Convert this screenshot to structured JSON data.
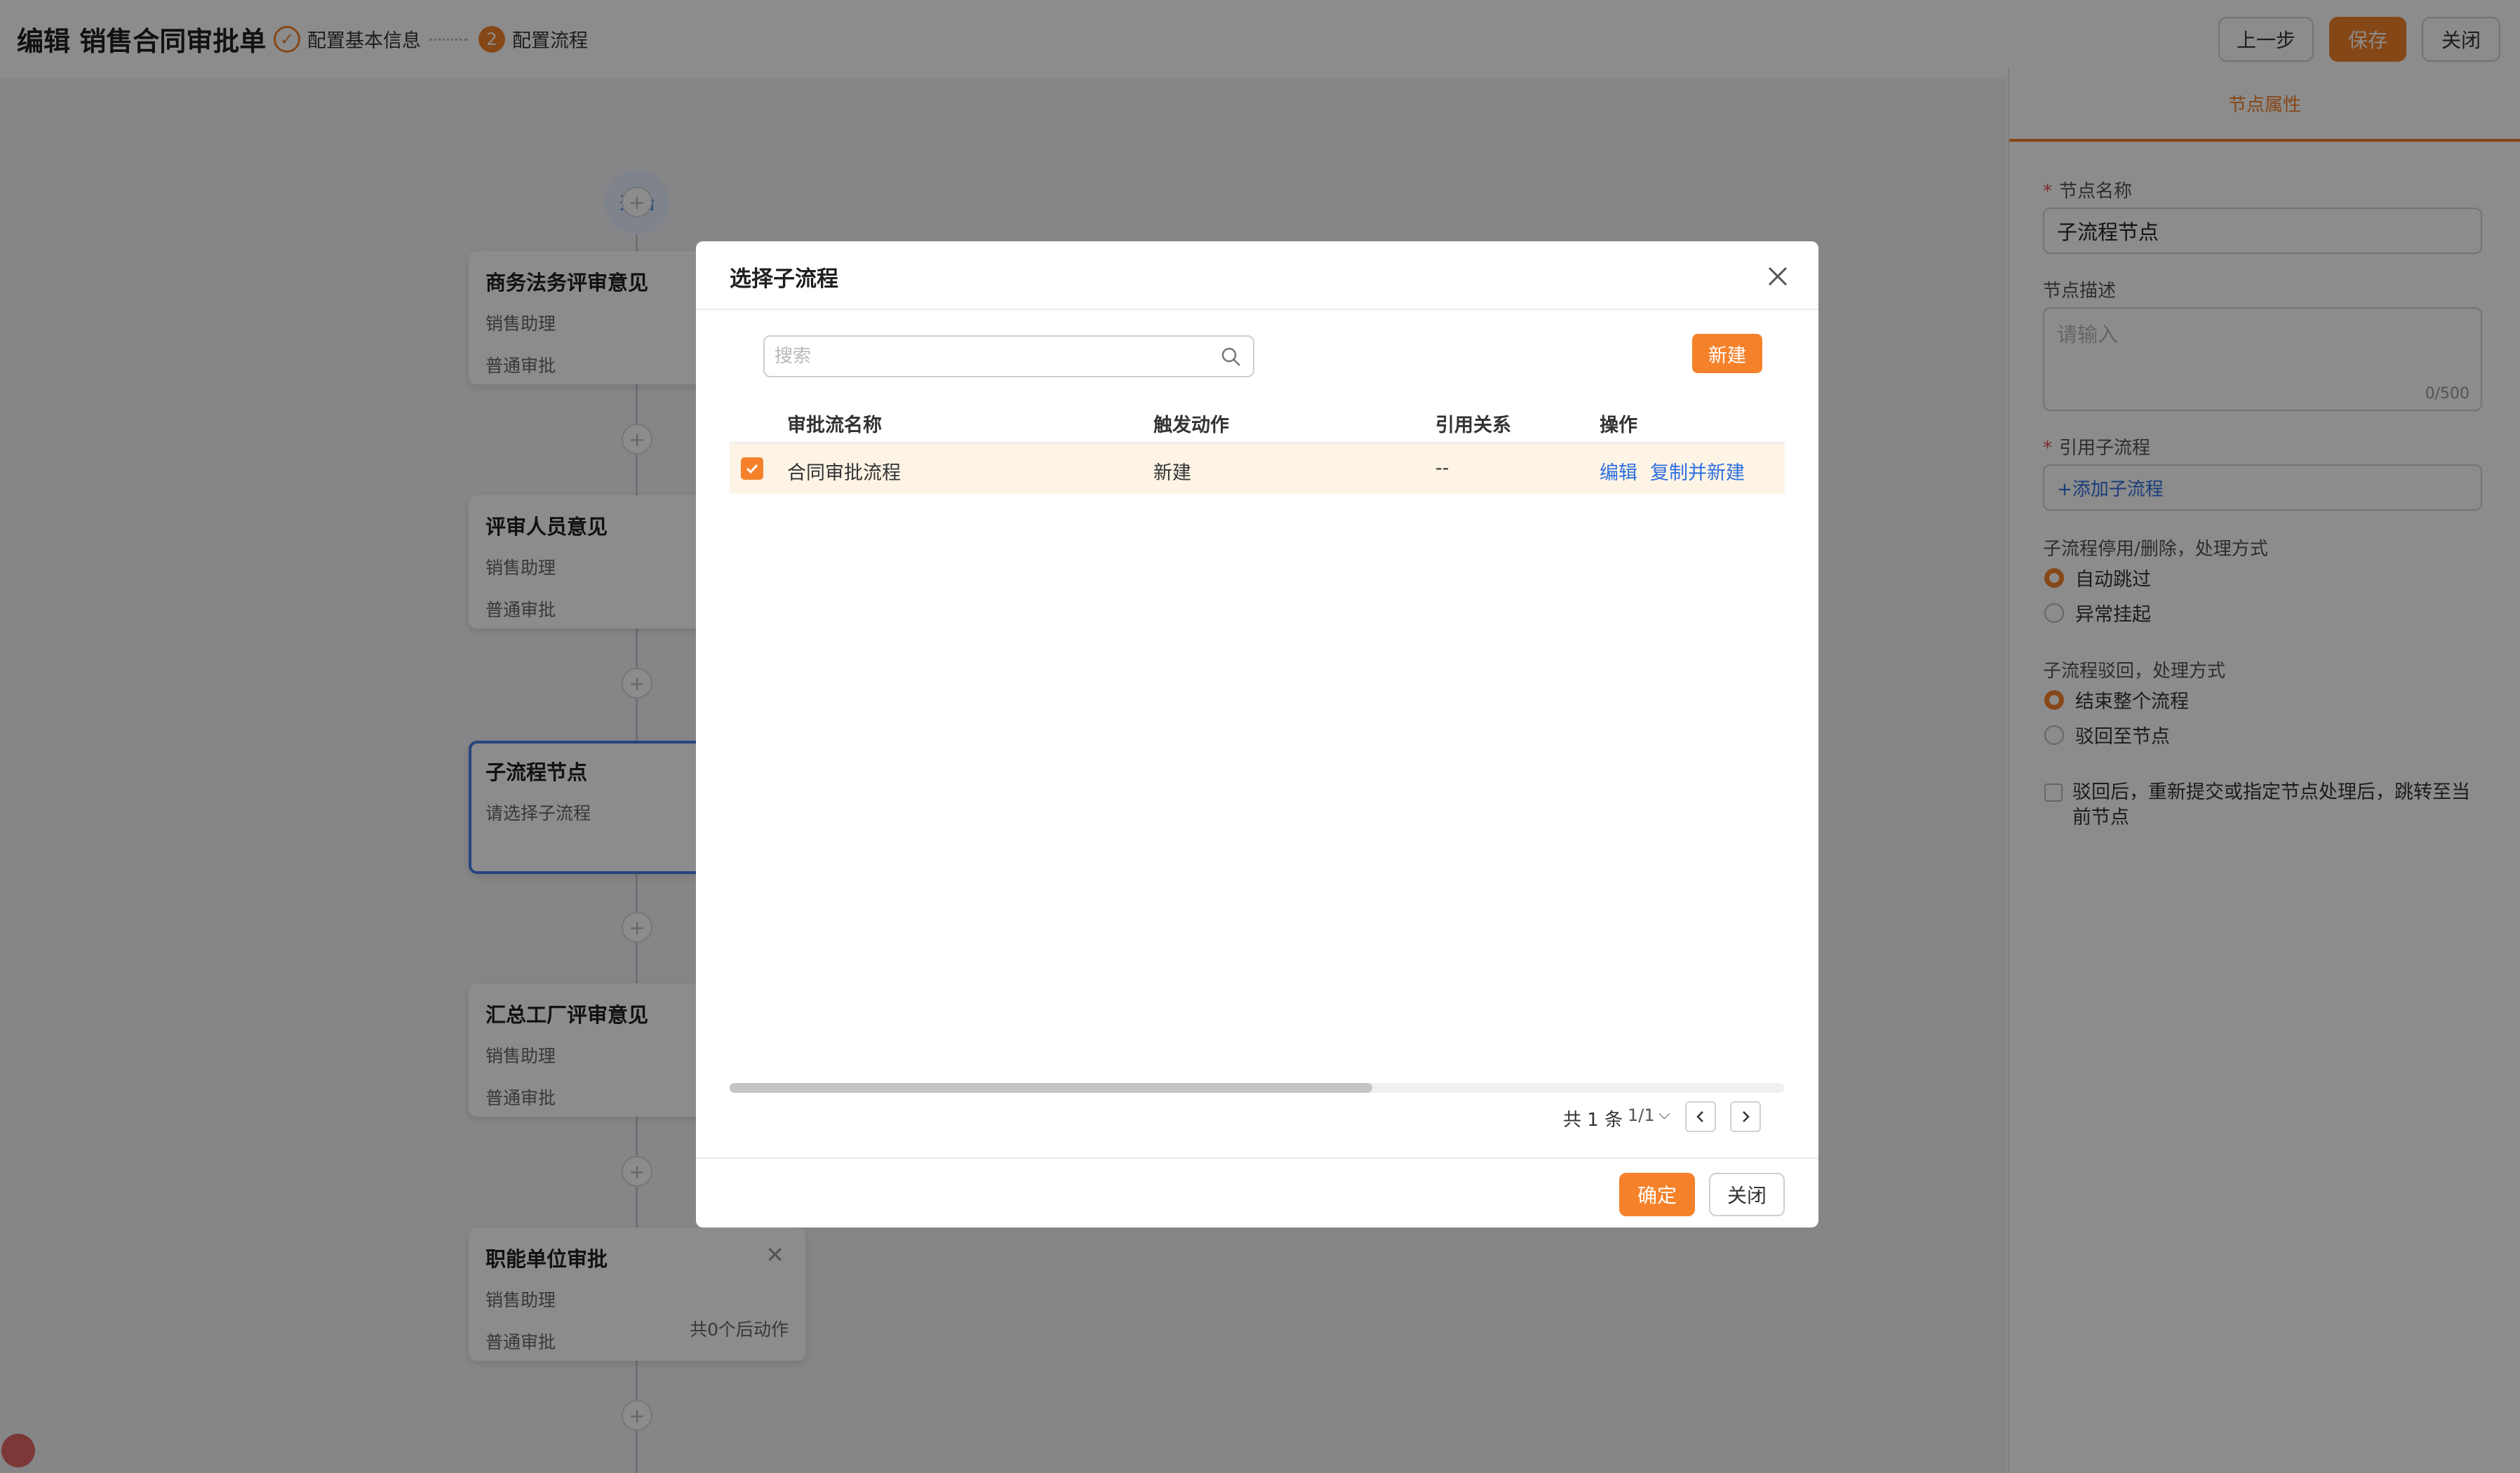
{
  "header": {
    "title": "编辑 销售合同审批单",
    "steps": [
      {
        "label": "配置基本信息",
        "badge": "✓"
      },
      {
        "label": "配置流程",
        "badge": "2"
      }
    ],
    "buttons": {
      "prev": "上一步",
      "save": "保存",
      "close": "关闭"
    }
  },
  "canvas": {
    "start_label": "开始",
    "nodes": [
      {
        "title": "商务法务评审意见",
        "role": "销售助理",
        "type": "普通审批"
      },
      {
        "title": "评审人员意见",
        "role": "销售助理",
        "type": "普通审批"
      },
      {
        "title": "子流程节点",
        "role": "请选择子流程",
        "type": ""
      },
      {
        "title": "汇总工厂评审意见",
        "role": "销售助理",
        "type": "普通审批"
      },
      {
        "title": "职能单位审批",
        "role": "销售助理",
        "type": "普通审批",
        "extra": "共0个后动作"
      }
    ]
  },
  "right_panel": {
    "tab": "节点属性",
    "name_label": "节点名称",
    "name_value": "子流程节点",
    "desc_label": "节点描述",
    "desc_placeholder": "请输入",
    "desc_count": "0/500",
    "ref_label": "引用子流程",
    "ref_link": "+添加子流程",
    "disable_label": "子流程停用/删除，处理方式",
    "disable_options": [
      "自动跳过",
      "异常挂起"
    ],
    "reject_label": "子流程驳回，处理方式",
    "reject_options": [
      "结束整个流程",
      "驳回至节点"
    ],
    "checkbox_label": "驳回后，重新提交或指定节点处理后，跳转至当前节点"
  },
  "modal": {
    "title": "选择子流程",
    "search_placeholder": "搜索",
    "new_button": "新建",
    "columns": [
      "审批流名称",
      "触发动作",
      "引用关系",
      "操作"
    ],
    "rows": [
      {
        "name": "合同审批流程",
        "action": "新建",
        "relation": "--",
        "ops": [
          "编辑",
          "复制并新建"
        ],
        "checked": true
      }
    ],
    "pager": {
      "total": "共 1 条",
      "page": "1/1"
    },
    "ok": "确定",
    "cancel": "关闭"
  },
  "colors": {
    "accent": "#f5822b",
    "link": "#2e6fe0",
    "selected_row": "#fdf4e6"
  }
}
